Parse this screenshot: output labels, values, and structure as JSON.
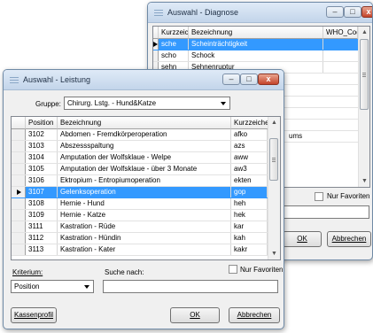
{
  "diagnose": {
    "title": "Auswahl - Diagnose",
    "columns": [
      "Kurzzeichen",
      "Bezeichnung",
      "WHO_Code"
    ],
    "rows": [
      {
        "kurz": "sche",
        "bez": "Scheinträchtigkeit",
        "selected": true
      },
      {
        "kurz": "scho",
        "bez": "Schock",
        "selected": false
      },
      {
        "kurz": "sehn",
        "bez": "Sehnenruptur",
        "selected": false
      }
    ],
    "partial_text": "ums",
    "favorites_label": "Nur Favoriten",
    "ok_label": "OK",
    "cancel_label": "Abbrechen"
  },
  "leistung": {
    "title": "Auswahl - Leistung",
    "group_label": "Gruppe:",
    "group_value": "Chirurg. Lstg. - Hund&Katze",
    "columns": [
      "Position",
      "Bezeichnung",
      "Kurzzeichen"
    ],
    "rows": [
      {
        "pos": "3102",
        "bez": "Abdomen - Fremdkörperoperation",
        "kurz": "afko",
        "selected": false
      },
      {
        "pos": "3103",
        "bez": "Abszessspaltung",
        "kurz": "azs",
        "selected": false
      },
      {
        "pos": "3104",
        "bez": "Amputation der Wolfsklaue - Welpe",
        "kurz": "aww",
        "selected": false
      },
      {
        "pos": "3105",
        "bez": "Amputation der Wolfsklaue - über 3 Monate",
        "kurz": "aw3",
        "selected": false
      },
      {
        "pos": "3106",
        "bez": "Ektropium - Entropiumoperation",
        "kurz": "ekten",
        "selected": false
      },
      {
        "pos": "3107",
        "bez": "Gelenksoperation",
        "kurz": "gop",
        "selected": true
      },
      {
        "pos": "3108",
        "bez": "Hernie - Hund",
        "kurz": "heh",
        "selected": false
      },
      {
        "pos": "3109",
        "bez": "Hernie - Katze",
        "kurz": "hek",
        "selected": false
      },
      {
        "pos": "3111",
        "bez": "Kastration - Rüde",
        "kurz": "kar",
        "selected": false
      },
      {
        "pos": "3112",
        "bez": "Kastration - Hündin",
        "kurz": "kah",
        "selected": false
      },
      {
        "pos": "3113",
        "bez": "Kastration - Kater",
        "kurz": "kakr",
        "selected": false
      }
    ],
    "criterion_label": "Kriterium:",
    "criterion_value": "Position",
    "search_label": "Suche nach:",
    "search_value": "",
    "favorites_label": "Nur Favoriten",
    "kassenprofil_label": "Kassenprofil",
    "ok_label": "OK",
    "cancel_label": "Abbrechen"
  }
}
